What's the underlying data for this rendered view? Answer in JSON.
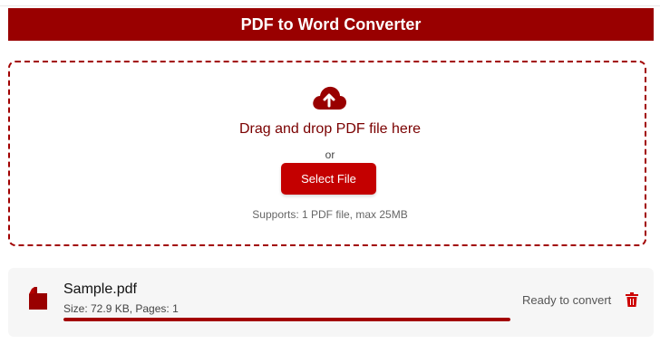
{
  "header": {
    "title": "PDF to Word Converter"
  },
  "dropzone": {
    "prompt": "Drag and drop PDF file here",
    "or_text": "or",
    "select_button_label": "Select File",
    "supports_text": "Supports: 1 PDF file, max 25MB",
    "icon": "cloud-upload-icon"
  },
  "file": {
    "name": "Sample.pdf",
    "meta": "Size: 72.9 KB, Pages: 1",
    "status": "Ready to convert",
    "progress_percent": 100,
    "file_icon": "pdf-file-icon",
    "delete_icon": "trash-icon"
  },
  "colors": {
    "brand": "#990000",
    "button": "#c40000",
    "dashed_border": "#a10000",
    "prompt_text": "#7a0000",
    "delete_icon": "#cc0000"
  }
}
